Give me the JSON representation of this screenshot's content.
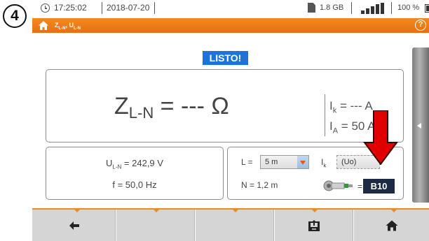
{
  "step_badge": "4",
  "statusbar": {
    "time": "17:25:02",
    "date": "2018-07-20",
    "memory": "1.8 GB",
    "battery": "100 %"
  },
  "titlebar": {
    "title_main": "Z",
    "title_main_sub": "L-N",
    "title_sep": ", ",
    "title_second": "U",
    "title_second_sub": "L-N",
    "help": "?"
  },
  "status_label": "LISTO!",
  "result": {
    "symbol": "Z",
    "symbol_sub": "L-N",
    "value_text": " = --- Ω",
    "ik_symbol": "I",
    "ik_sub": "k",
    "ik_value": " = --- A",
    "ia_symbol": "I",
    "ia_sub": "A",
    "ia_value": " = 50 A"
  },
  "voltage_panel": {
    "u_symbol": "U",
    "u_sub": "L-N",
    "u_value": " = 242,9 V",
    "f_text": "f = 50,0 Hz"
  },
  "settings_panel": {
    "l_label": "L =",
    "l_value": "5 m",
    "ik_symbol": "I",
    "ik_sub": "k",
    "ik_mode": "(Uo)",
    "n_text": "N = 1,2 m",
    "fuse_eq": "=",
    "fuse_value": "B10"
  },
  "colors": {
    "accent_orange": "#f08a20",
    "status_blue": "#1e72d8",
    "annotation_red": "#e00000",
    "fuse_badge": "#1d2a44"
  },
  "toolbar": {
    "icons": [
      "back-arrow-icon",
      "",
      "",
      "save-icon",
      "home-icon"
    ]
  }
}
